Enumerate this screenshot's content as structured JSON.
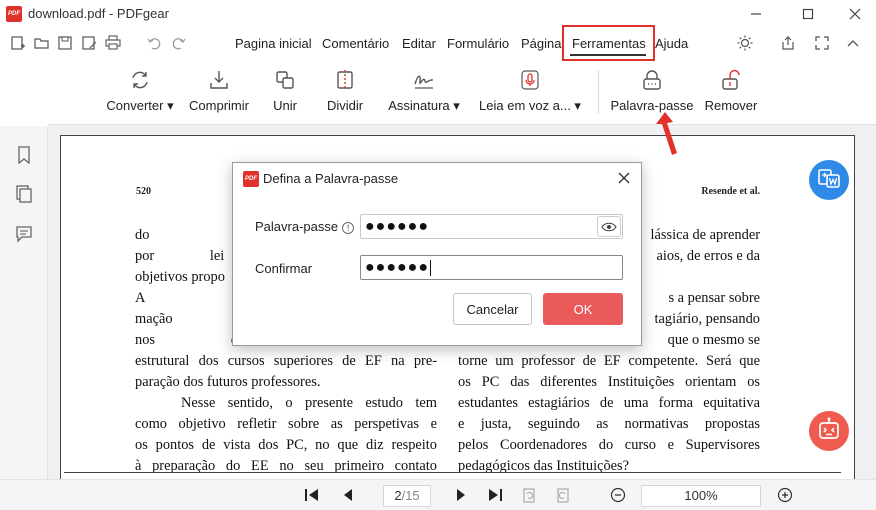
{
  "window": {
    "title": "download.pdf - PDFgear",
    "logo_text": "PDF"
  },
  "menu": {
    "items": [
      "Pagina inicial",
      "Comentário",
      "Editar",
      "Formulário",
      "Página",
      "Ferramentas",
      "Ajuda"
    ],
    "active": "Ferramentas"
  },
  "ribbon": {
    "tools": [
      {
        "label": "Converter ▾",
        "icon": "convert-icon"
      },
      {
        "label": "Comprimir",
        "icon": "compress-icon"
      },
      {
        "label": "Unir",
        "icon": "merge-icon"
      },
      {
        "label": "Dividir",
        "icon": "split-icon"
      },
      {
        "label": "Assinatura ▾",
        "icon": "signature-icon"
      },
      {
        "label": "Leia em voz a... ▾",
        "icon": "microphone-icon"
      },
      {
        "label": "Palavra-passe",
        "icon": "lock-icon"
      },
      {
        "label": "Remover",
        "icon": "unlock-icon"
      }
    ]
  },
  "document": {
    "page_number": "520",
    "running_header": "Resende et al.",
    "left_column": [
      "do cumprimento",
      "por lei e para qu",
      "objetivos propo",
      "A importância d",
      "mação inicial d",
      "nos dar uma id",
      "estrutural dos cursos superiores de EF na pre-",
      "paração dos futuros professores.",
      "Nesse sentido, o presente estudo tem",
      "como objetivo refletir sobre as perspetivas e",
      "os pontos de vista dos PC, no que diz respeito",
      "à preparação do EE no seu primeiro contato"
    ],
    "right_column": [
      "lássica de aprender",
      "aios, de erros e da",
      "",
      "s a pensar sobre",
      "tagiário, pensando",
      "que o mesmo se",
      "torne um professor de EF competente. Será que",
      "os PC das diferentes Instituições orientam os",
      "estudantes estagiários de uma forma equitativa",
      "e justa, seguindo as normativas propostas",
      "pelos Coordenadores do curso e Supervisores",
      "pedagógicos das Instituições?"
    ]
  },
  "bottom_bar": {
    "current_page": "2",
    "total_pages": "/15",
    "zoom": "100%"
  },
  "dialog": {
    "title": "Defina a Palavra-passe",
    "password_label": "Palavra-passe",
    "password_value": "●●●●●●",
    "confirm_label": "Confirmar",
    "confirm_value": "●●●●●●",
    "cancel_label": "Cancelar",
    "ok_label": "OK"
  },
  "colors": {
    "accent_red": "#e0322b",
    "ok_button": "#eb5a5a",
    "float_blue": "#2e8ae6",
    "float_red": "#ef5b4e"
  }
}
